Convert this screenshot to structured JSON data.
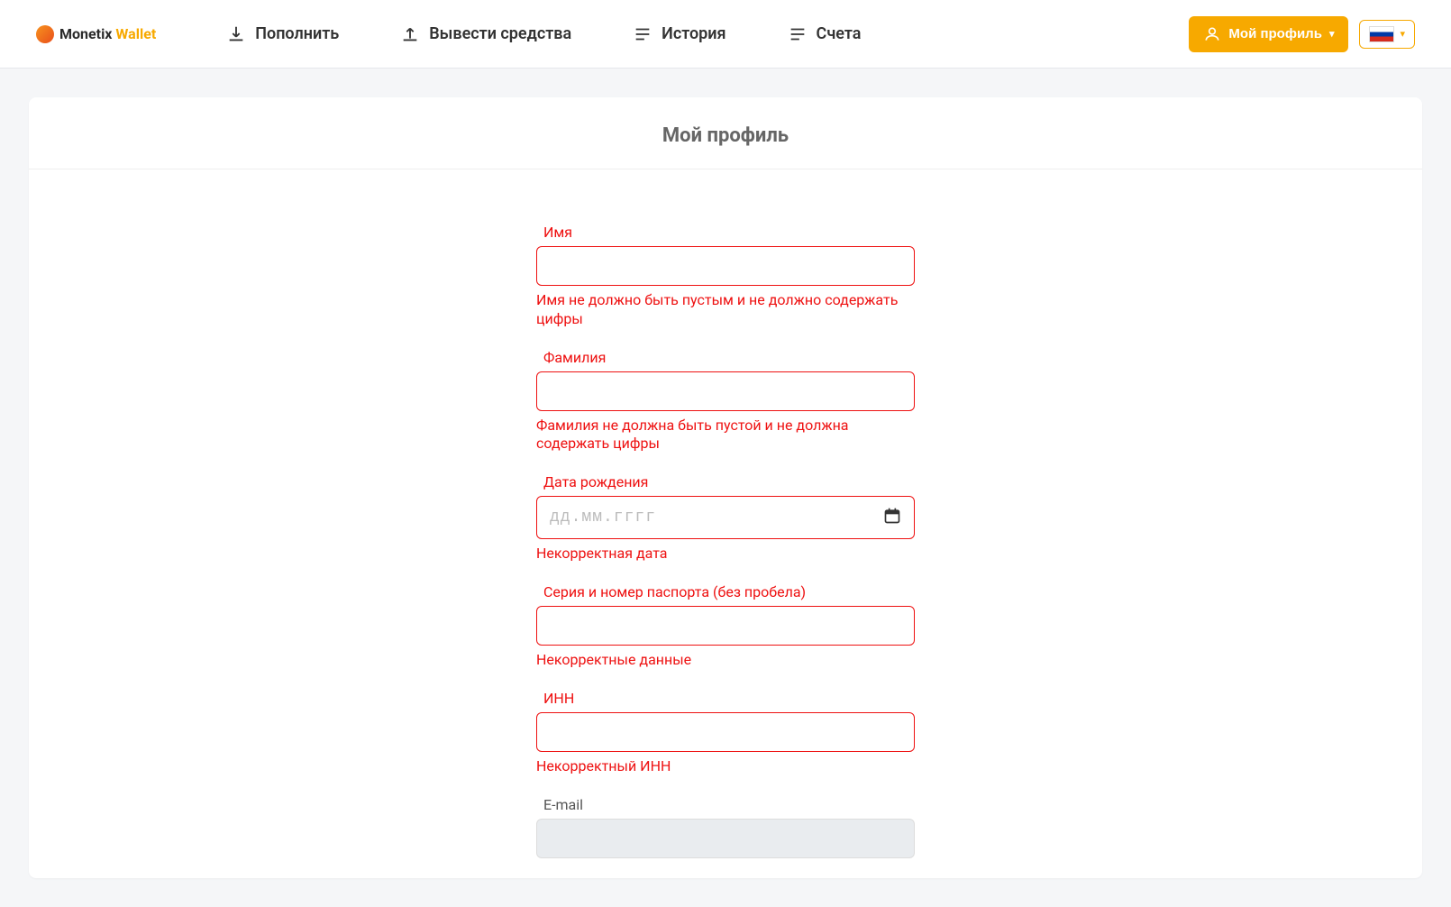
{
  "brand": {
    "name_dark": "Monetix",
    "name_accent": "Wallet"
  },
  "nav": {
    "topup": "Пополнить",
    "withdraw": "Вывести средства",
    "history": "История",
    "accounts": "Счета"
  },
  "header_right": {
    "profile_btn": "Мой профиль"
  },
  "page": {
    "title": "Мой профиль"
  },
  "form": {
    "first_name": {
      "label": "Имя",
      "value": "",
      "error": "Имя не должно быть пустым и не должно содержать цифры"
    },
    "last_name": {
      "label": "Фамилия",
      "value": "",
      "error": "Фамилия не должна быть пустой и не должна содержать цифры"
    },
    "dob": {
      "label": "Дата рождения",
      "placeholder": "дд.мм.гггг",
      "error": "Некорректная дата"
    },
    "passport": {
      "label": "Серия и номер паспорта (без пробела)",
      "value": "",
      "error": "Некорректные данные"
    },
    "inn": {
      "label": "ИНН",
      "value": "",
      "error": "Некорректный ИНН"
    },
    "email": {
      "label": "E-mail",
      "value": ""
    }
  }
}
